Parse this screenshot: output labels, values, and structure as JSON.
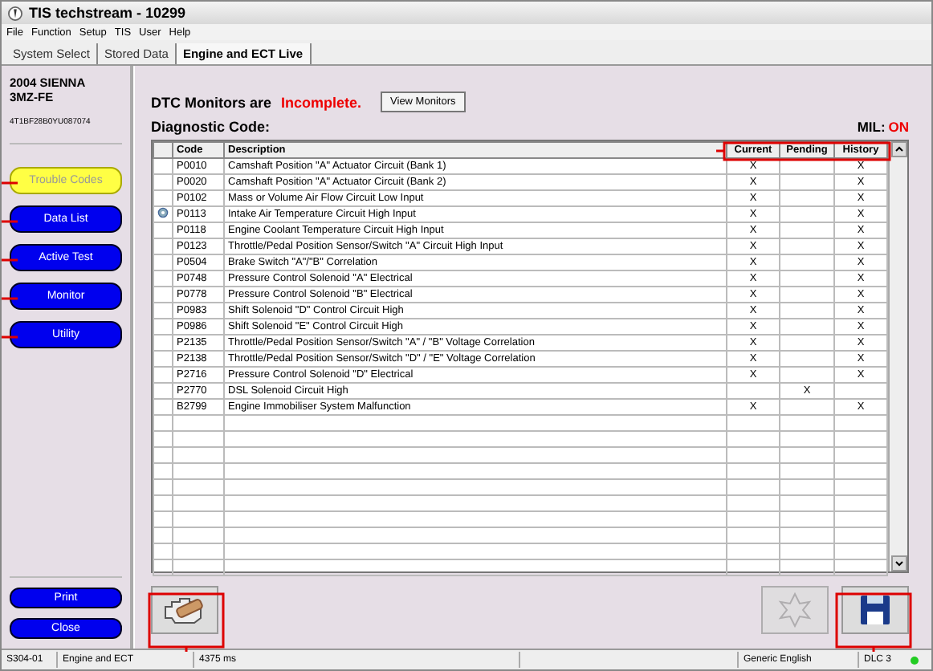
{
  "window": {
    "title": "TIS techstream - 10299"
  },
  "menu": [
    "File",
    "Function",
    "Setup",
    "TIS",
    "User",
    "Help"
  ],
  "tabs": [
    {
      "label": "System Select",
      "selected": false
    },
    {
      "label": "Stored Data",
      "selected": false
    },
    {
      "label": "Engine and ECT Live",
      "selected": true
    }
  ],
  "vehicle": {
    "model": "2004 SIENNA",
    "engine": "3MZ-FE",
    "vin": "4T1BF28B0YU087074"
  },
  "nav": [
    {
      "label": "Trouble Codes",
      "selected": true
    },
    {
      "label": "Data List",
      "selected": false
    },
    {
      "label": "Active Test",
      "selected": false
    },
    {
      "label": "Monitor",
      "selected": false
    },
    {
      "label": "Utility",
      "selected": false
    }
  ],
  "bottom_buttons": [
    "Print",
    "Close"
  ],
  "dtc_monitors": {
    "label": "DTC Monitors are",
    "status": "Incomplete.",
    "button": "View Monitors"
  },
  "diagnostic_label": "Diagnostic Code:",
  "mil": {
    "label": "MIL:",
    "status": "ON"
  },
  "table": {
    "columns": [
      "Code",
      "Description",
      "Current",
      "Pending",
      "History"
    ],
    "rows": [
      {
        "code": "P0010",
        "description": "Camshaft Position \"A\" Actuator Circuit  (Bank 1)",
        "current": "X",
        "pending": "",
        "history": "X",
        "flagged": false
      },
      {
        "code": "P0020",
        "description": "Camshaft Position \"A\" Actuator Circuit  (Bank 2)",
        "current": "X",
        "pending": "",
        "history": "X",
        "flagged": false
      },
      {
        "code": "P0102",
        "description": "Mass or Volume Air Flow Circuit Low Input",
        "current": "X",
        "pending": "",
        "history": "X",
        "flagged": false
      },
      {
        "code": "P0113",
        "description": "Intake Air Temperature Circuit High Input",
        "current": "X",
        "pending": "",
        "history": "X",
        "flagged": true
      },
      {
        "code": "P0118",
        "description": "Engine Coolant Temperature Circuit High Input",
        "current": "X",
        "pending": "",
        "history": "X",
        "flagged": false
      },
      {
        "code": "P0123",
        "description": "Throttle/Pedal Position Sensor/Switch \"A\" Circuit High Input",
        "current": "X",
        "pending": "",
        "history": "X",
        "flagged": false
      },
      {
        "code": "P0504",
        "description": "Brake Switch \"A\"/\"B\" Correlation",
        "current": "X",
        "pending": "",
        "history": "X",
        "flagged": false
      },
      {
        "code": "P0748",
        "description": "Pressure Control Solenoid \"A\" Electrical",
        "current": "X",
        "pending": "",
        "history": "X",
        "flagged": false
      },
      {
        "code": "P0778",
        "description": "Pressure Control Solenoid \"B\" Electrical",
        "current": "X",
        "pending": "",
        "history": "X",
        "flagged": false
      },
      {
        "code": "P0983",
        "description": "Shift Solenoid \"D\" Control Circuit High",
        "current": "X",
        "pending": "",
        "history": "X",
        "flagged": false
      },
      {
        "code": "P0986",
        "description": "Shift Solenoid \"E\" Control Circuit High",
        "current": "X",
        "pending": "",
        "history": "X",
        "flagged": false
      },
      {
        "code": "P2135",
        "description": "Throttle/Pedal Position Sensor/Switch \"A\" / \"B\" Voltage  Correlation",
        "current": "X",
        "pending": "",
        "history": "X",
        "flagged": false
      },
      {
        "code": "P2138",
        "description": "Throttle/Pedal Position Sensor/Switch \"D\" / \"E\" Voltage  Correlation",
        "current": "X",
        "pending": "",
        "history": "X",
        "flagged": false
      },
      {
        "code": "P2716",
        "description": "Pressure Control Solenoid \"D\" Electrical",
        "current": "X",
        "pending": "",
        "history": "X",
        "flagged": false
      },
      {
        "code": "P2770",
        "description": "DSL Solenoid Circuit High",
        "current": "",
        "pending": "X",
        "history": "",
        "flagged": false
      },
      {
        "code": "B2799",
        "description": "Engine Immobiliser System Malfunction",
        "current": "X",
        "pending": "",
        "history": "X",
        "flagged": false
      }
    ]
  },
  "status_bar": [
    "S304-01",
    "Engine and ECT",
    "4375 ms",
    "Generic English",
    "DLC 3"
  ]
}
